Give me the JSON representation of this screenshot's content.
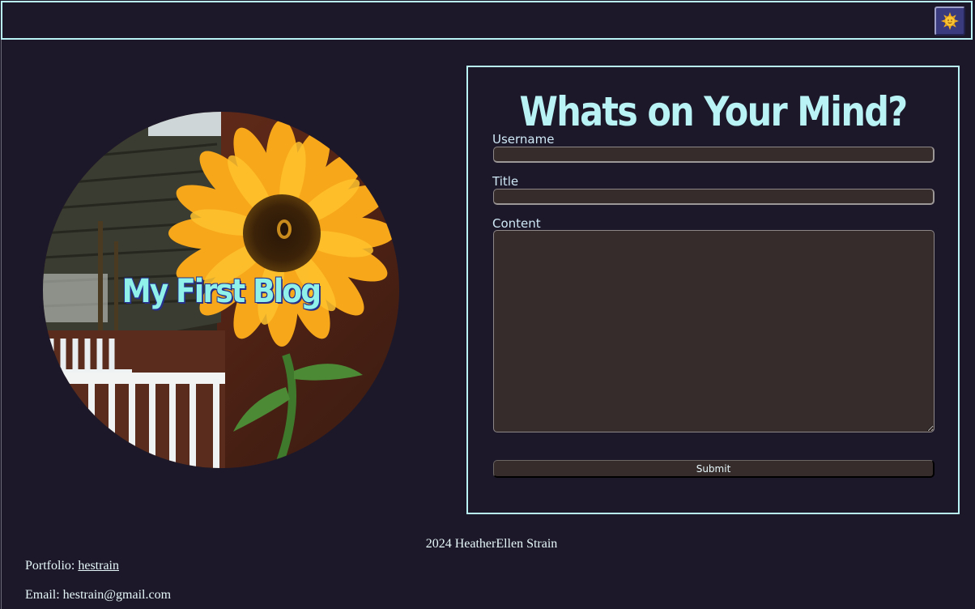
{
  "header": {
    "mode_toggle_icon": "sun-icon"
  },
  "hero": {
    "title": "My First Blog",
    "image": "sunflower-photo"
  },
  "form": {
    "title": "Whats on Your Mind?",
    "username_label": "Username",
    "title_label": "Title",
    "content_label": "Content",
    "submit_label": "Submit"
  },
  "footer": {
    "credit": "2024 HeatherEllen Strain",
    "portfolio_label": "Portfolio:",
    "portfolio_link": "hestrain",
    "email_text": "Email: hestrain@gmail.com"
  },
  "colors": {
    "background": "#1d1829",
    "accent": "#b9f3f5",
    "hero_title": "#8ff1ea",
    "input_bg": "#352c2b"
  }
}
